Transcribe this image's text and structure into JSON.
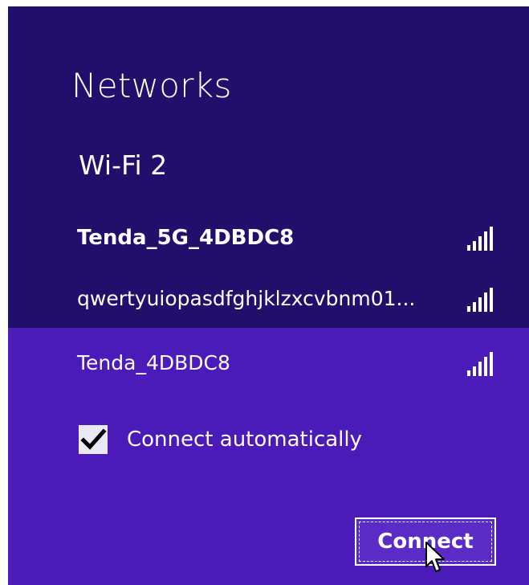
{
  "panel": {
    "title": "Networks",
    "adapter_name": "Wi-Fi 2"
  },
  "networks": [
    {
      "ssid": "Tenda_5G_4DBDC8",
      "signal_icon": "wifi-signal-bars-icon",
      "signal_bars": 5,
      "connected": true
    },
    {
      "ssid": "qwertyuiopasdfghjklzxcvbnm01...",
      "signal_icon": "wifi-signal-bars-icon",
      "signal_bars": 5,
      "connected": false
    },
    {
      "ssid": "Tenda_4DBDC8",
      "signal_icon": "wifi-signal-bars-icon",
      "signal_bars": 5,
      "connected": false,
      "selected": true
    }
  ],
  "selected_network": {
    "auto_connect_label": "Connect automatically",
    "auto_connect_checked": true,
    "connect_button_label": "Connect"
  },
  "colors": {
    "panel_bg": "#210f6b",
    "selected_bg": "#4b1ab8",
    "text": "#ffffff"
  }
}
